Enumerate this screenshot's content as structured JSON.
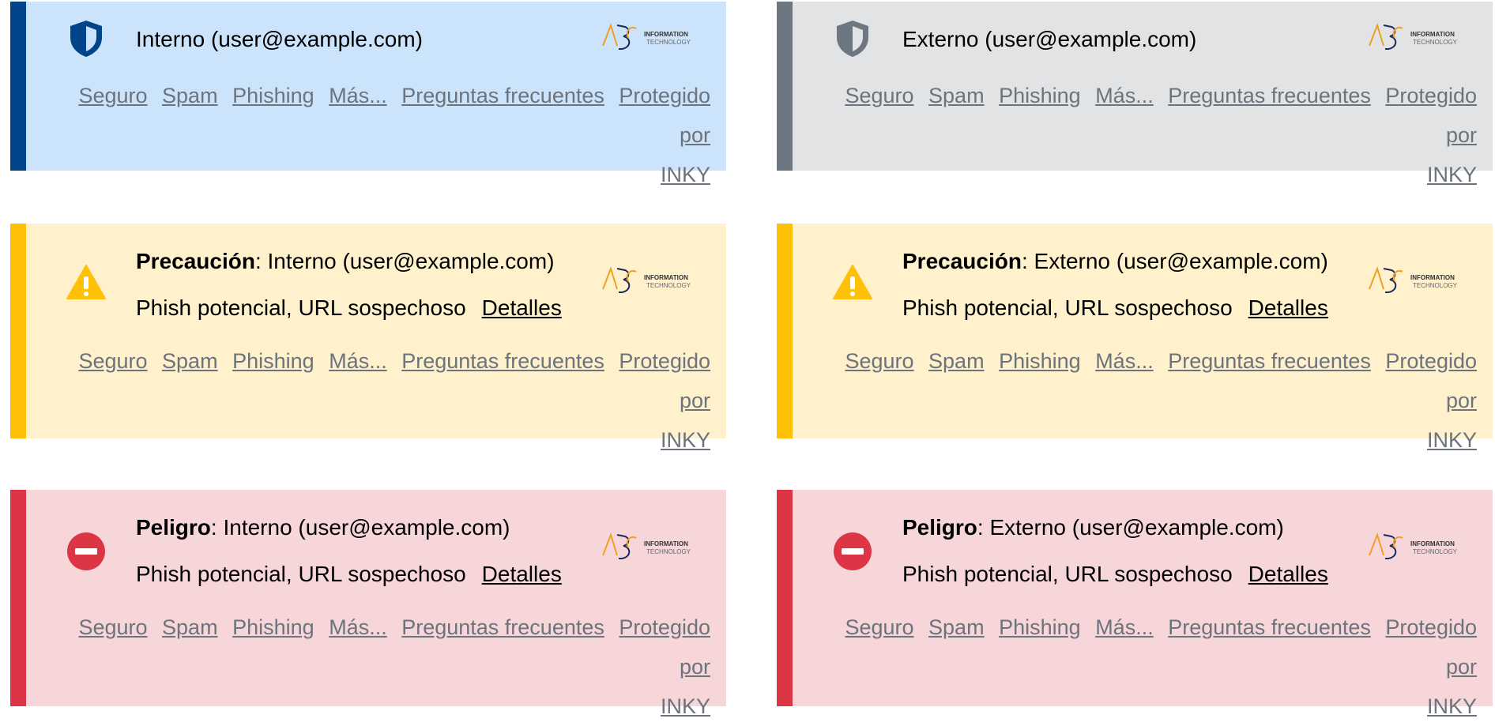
{
  "colors": {
    "info_stripe": "#00458a",
    "info_bg": "#cce4fb",
    "external_stripe": "#6d7681",
    "external_bg": "#e2e3e5",
    "warning_stripe": "#ffc107",
    "warning_bg": "#fff1cc",
    "danger_stripe": "#dc3545",
    "danger_bg": "#f7d6da",
    "link_gray": "#6c737c"
  },
  "logo": {
    "mark": "ABC",
    "line1": "INFORMATION",
    "line2": "TECHNOLOGY"
  },
  "links": {
    "safe": "Seguro",
    "spam": "Spam",
    "phishing": "Phishing",
    "more": "Más...",
    "faq": "Preguntas frecuentes",
    "protected": "Protegido por",
    "inky": "INKY"
  },
  "banners": {
    "internal_safe": {
      "icon": "shield-icon",
      "title": "Interno (user@example.com)"
    },
    "external_safe": {
      "icon": "shield-icon",
      "title": "Externo (user@example.com)"
    },
    "internal_caution": {
      "icon": "warning-triangle-icon",
      "level": "Precaución",
      "title": ": Interno (user@example.com)",
      "detail": "Phish potencial, URL sospechoso",
      "details_link": "Detalles"
    },
    "external_caution": {
      "icon": "warning-triangle-icon",
      "level": "Precaución",
      "title": ": Externo (user@example.com)",
      "detail": "Phish potencial, URL sospechoso",
      "details_link": "Detalles"
    },
    "internal_danger": {
      "icon": "danger-circle-icon",
      "level": "Peligro",
      "title": ": Interno (user@example.com)",
      "detail": "Phish potencial, URL sospechoso",
      "details_link": "Detalles"
    },
    "external_danger": {
      "icon": "danger-circle-icon",
      "level": "Peligro",
      "title": ": Externo (user@example.com)",
      "detail": "Phish potencial, URL sospechoso",
      "details_link": "Detalles"
    }
  }
}
